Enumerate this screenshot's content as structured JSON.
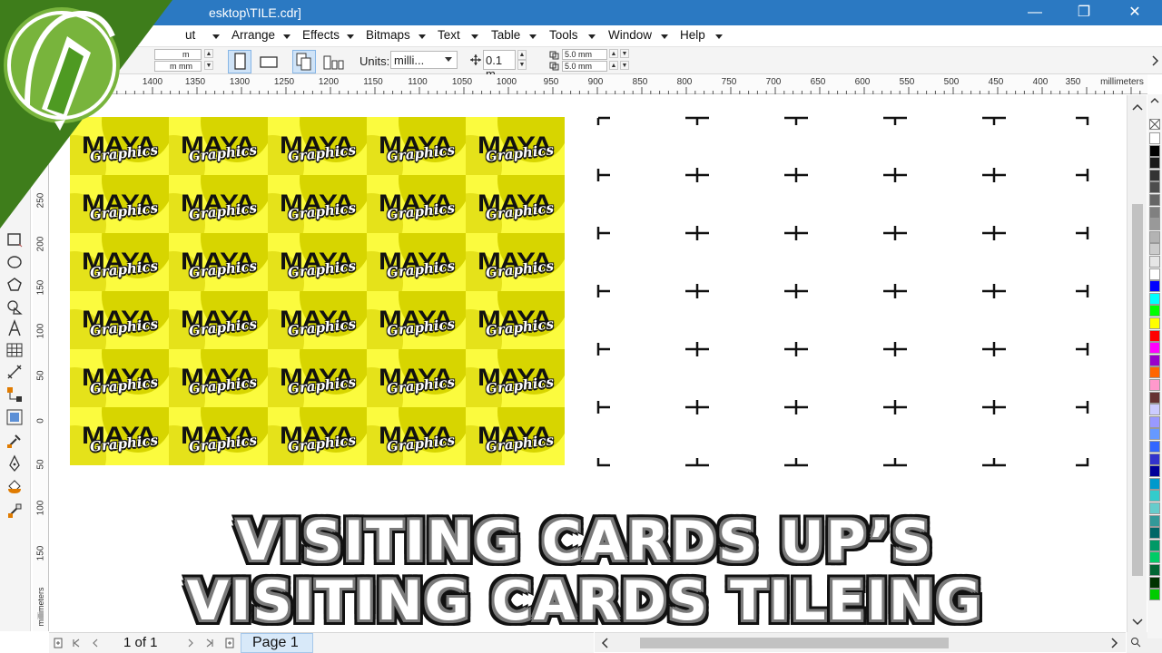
{
  "window": {
    "title": "esktop\\TILE.cdr]",
    "minimize_glyph": "—",
    "maximize_glyph": "❐",
    "close_glyph": "✕"
  },
  "menu": {
    "items": [
      {
        "label": "ut"
      },
      {
        "label": "Arrange"
      },
      {
        "label": "Effects"
      },
      {
        "label": "Bitmaps"
      },
      {
        "label": "Text"
      },
      {
        "label": "Table"
      },
      {
        "label": "Tools"
      },
      {
        "label": "Window"
      },
      {
        "label": "Help"
      }
    ]
  },
  "propbar": {
    "size_w_fragment": "m",
    "size_h_fragment": "m mm",
    "units_label": "Units:",
    "units_value": "milli...",
    "nudge_value": "0.1 m",
    "dup_x": "5.0 mm",
    "dup_y": "5.0 mm"
  },
  "ruler": {
    "units_label": "millimeters",
    "h_labels": [
      "1400",
      "1350",
      "1300",
      "1250",
      "1200",
      "1150",
      "1100",
      "1050",
      "1000",
      "950",
      "900",
      "850",
      "800",
      "750",
      "700",
      "650",
      "600",
      "550",
      "500",
      "450",
      "400",
      "350"
    ],
    "v_labels": [
      "250",
      "200",
      "150",
      "100",
      "50",
      "0",
      "50",
      "100",
      "150"
    ],
    "v_units_label": "millimeters"
  },
  "card": {
    "brand_top": "MAYA",
    "brand_bottom": "Graphics"
  },
  "pagenav": {
    "page_count": "1 of 1",
    "page_tab": "Page 1"
  },
  "caption": {
    "line1": "VISITING CARDS UP’S",
    "line2": "VISITING CARDS TILEING"
  },
  "palette": {
    "colors": [
      "#ffffff",
      "#000000",
      "#1a1a1a",
      "#333333",
      "#4d4d4d",
      "#666666",
      "#808080",
      "#999999",
      "#b3b3b3",
      "#cccccc",
      "#e6e6e6",
      "#ffffff",
      "#0000ff",
      "#00ffff",
      "#00ff00",
      "#ffff00",
      "#ff0000",
      "#ff00ff",
      "#9900cc",
      "#ff6600",
      "#ff99cc",
      "#663333",
      "#ccccff",
      "#9999ff",
      "#6699ff",
      "#3366ff",
      "#3333cc",
      "#000099",
      "#0099cc",
      "#33cccc",
      "#66cccc",
      "#339999",
      "#006666",
      "#009966",
      "#00cc66",
      "#006633",
      "#003300",
      "#00cc00"
    ]
  }
}
